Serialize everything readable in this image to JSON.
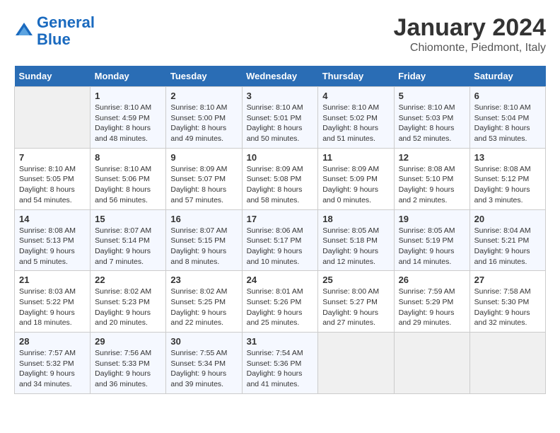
{
  "header": {
    "logo_line1": "General",
    "logo_line2": "Blue",
    "month": "January 2024",
    "location": "Chiomonte, Piedmont, Italy"
  },
  "weekdays": [
    "Sunday",
    "Monday",
    "Tuesday",
    "Wednesday",
    "Thursday",
    "Friday",
    "Saturday"
  ],
  "weeks": [
    [
      {
        "day": "",
        "info": ""
      },
      {
        "day": "1",
        "info": "Sunrise: 8:10 AM\nSunset: 4:59 PM\nDaylight: 8 hours\nand 48 minutes."
      },
      {
        "day": "2",
        "info": "Sunrise: 8:10 AM\nSunset: 5:00 PM\nDaylight: 8 hours\nand 49 minutes."
      },
      {
        "day": "3",
        "info": "Sunrise: 8:10 AM\nSunset: 5:01 PM\nDaylight: 8 hours\nand 50 minutes."
      },
      {
        "day": "4",
        "info": "Sunrise: 8:10 AM\nSunset: 5:02 PM\nDaylight: 8 hours\nand 51 minutes."
      },
      {
        "day": "5",
        "info": "Sunrise: 8:10 AM\nSunset: 5:03 PM\nDaylight: 8 hours\nand 52 minutes."
      },
      {
        "day": "6",
        "info": "Sunrise: 8:10 AM\nSunset: 5:04 PM\nDaylight: 8 hours\nand 53 minutes."
      }
    ],
    [
      {
        "day": "7",
        "info": "Sunrise: 8:10 AM\nSunset: 5:05 PM\nDaylight: 8 hours\nand 54 minutes."
      },
      {
        "day": "8",
        "info": "Sunrise: 8:10 AM\nSunset: 5:06 PM\nDaylight: 8 hours\nand 56 minutes."
      },
      {
        "day": "9",
        "info": "Sunrise: 8:09 AM\nSunset: 5:07 PM\nDaylight: 8 hours\nand 57 minutes."
      },
      {
        "day": "10",
        "info": "Sunrise: 8:09 AM\nSunset: 5:08 PM\nDaylight: 8 hours\nand 58 minutes."
      },
      {
        "day": "11",
        "info": "Sunrise: 8:09 AM\nSunset: 5:09 PM\nDaylight: 9 hours\nand 0 minutes."
      },
      {
        "day": "12",
        "info": "Sunrise: 8:08 AM\nSunset: 5:10 PM\nDaylight: 9 hours\nand 2 minutes."
      },
      {
        "day": "13",
        "info": "Sunrise: 8:08 AM\nSunset: 5:12 PM\nDaylight: 9 hours\nand 3 minutes."
      }
    ],
    [
      {
        "day": "14",
        "info": "Sunrise: 8:08 AM\nSunset: 5:13 PM\nDaylight: 9 hours\nand 5 minutes."
      },
      {
        "day": "15",
        "info": "Sunrise: 8:07 AM\nSunset: 5:14 PM\nDaylight: 9 hours\nand 7 minutes."
      },
      {
        "day": "16",
        "info": "Sunrise: 8:07 AM\nSunset: 5:15 PM\nDaylight: 9 hours\nand 8 minutes."
      },
      {
        "day": "17",
        "info": "Sunrise: 8:06 AM\nSunset: 5:17 PM\nDaylight: 9 hours\nand 10 minutes."
      },
      {
        "day": "18",
        "info": "Sunrise: 8:05 AM\nSunset: 5:18 PM\nDaylight: 9 hours\nand 12 minutes."
      },
      {
        "day": "19",
        "info": "Sunrise: 8:05 AM\nSunset: 5:19 PM\nDaylight: 9 hours\nand 14 minutes."
      },
      {
        "day": "20",
        "info": "Sunrise: 8:04 AM\nSunset: 5:21 PM\nDaylight: 9 hours\nand 16 minutes."
      }
    ],
    [
      {
        "day": "21",
        "info": "Sunrise: 8:03 AM\nSunset: 5:22 PM\nDaylight: 9 hours\nand 18 minutes."
      },
      {
        "day": "22",
        "info": "Sunrise: 8:02 AM\nSunset: 5:23 PM\nDaylight: 9 hours\nand 20 minutes."
      },
      {
        "day": "23",
        "info": "Sunrise: 8:02 AM\nSunset: 5:25 PM\nDaylight: 9 hours\nand 22 minutes."
      },
      {
        "day": "24",
        "info": "Sunrise: 8:01 AM\nSunset: 5:26 PM\nDaylight: 9 hours\nand 25 minutes."
      },
      {
        "day": "25",
        "info": "Sunrise: 8:00 AM\nSunset: 5:27 PM\nDaylight: 9 hours\nand 27 minutes."
      },
      {
        "day": "26",
        "info": "Sunrise: 7:59 AM\nSunset: 5:29 PM\nDaylight: 9 hours\nand 29 minutes."
      },
      {
        "day": "27",
        "info": "Sunrise: 7:58 AM\nSunset: 5:30 PM\nDaylight: 9 hours\nand 32 minutes."
      }
    ],
    [
      {
        "day": "28",
        "info": "Sunrise: 7:57 AM\nSunset: 5:32 PM\nDaylight: 9 hours\nand 34 minutes."
      },
      {
        "day": "29",
        "info": "Sunrise: 7:56 AM\nSunset: 5:33 PM\nDaylight: 9 hours\nand 36 minutes."
      },
      {
        "day": "30",
        "info": "Sunrise: 7:55 AM\nSunset: 5:34 PM\nDaylight: 9 hours\nand 39 minutes."
      },
      {
        "day": "31",
        "info": "Sunrise: 7:54 AM\nSunset: 5:36 PM\nDaylight: 9 hours\nand 41 minutes."
      },
      {
        "day": "",
        "info": ""
      },
      {
        "day": "",
        "info": ""
      },
      {
        "day": "",
        "info": ""
      }
    ]
  ]
}
